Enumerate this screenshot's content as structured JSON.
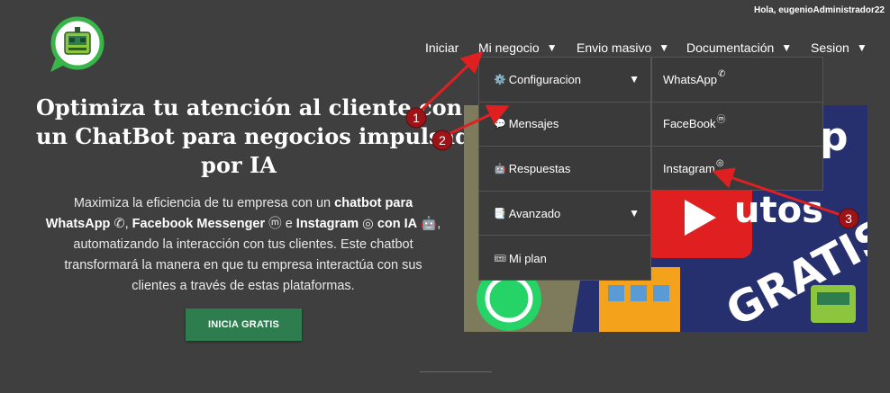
{
  "header": {
    "greeting": "Hola, eugenioAdministrador22"
  },
  "nav": {
    "items": [
      {
        "label": "Iniciar"
      },
      {
        "label": "Mi negocio"
      },
      {
        "label": "Envio masivo"
      },
      {
        "label": "Documentación"
      },
      {
        "label": "Sesion"
      }
    ],
    "caret": "▼"
  },
  "hero": {
    "title_lines": [
      "Optimiza tu atención al cliente con",
      "un ChatBot para negocios impulsado",
      "por IA"
    ],
    "desc_parts": {
      "p1": "Maximiza la eficiencia de tu empresa con un ",
      "b1": "chatbot para WhatsApp",
      "p2": ", ",
      "b2": "Facebook Messenger",
      "p3": " e ",
      "b3": "Instagram",
      "p4": " con IA",
      "p5": ", automatizando la interacción con tus clientes. Este chatbot transformará la manera en que tu empresa interactúa con sus clientes a través de estas plataformas."
    },
    "cta_label": "INICIA GRATIS"
  },
  "dropdown": {
    "items": [
      {
        "label": "Configuracion",
        "icon": "gear-icon",
        "has_submenu": true
      },
      {
        "label": "Mensajes",
        "icon": "chat-bubble-icon",
        "has_submenu": false
      },
      {
        "label": "Respuestas",
        "icon": "robot-icon",
        "has_submenu": false
      },
      {
        "label": "Avanzado",
        "icon": "document-icon",
        "has_submenu": true
      },
      {
        "label": "Mi plan",
        "icon": "ticket-icon",
        "has_submenu": false
      }
    ]
  },
  "submenu": {
    "items": [
      {
        "label": "WhatsApp",
        "icon": "whatsapp-icon"
      },
      {
        "label": "FaceBook",
        "icon": "messenger-icon"
      },
      {
        "label": "Instagram",
        "icon": "instagram-icon"
      }
    ]
  },
  "annotations": {
    "markers": [
      "1",
      "2",
      "3"
    ],
    "color": "#b3151c"
  },
  "colors": {
    "background": "#3f3f3f",
    "cta": "#2e7d4f",
    "logo_green": "#39b54a"
  }
}
